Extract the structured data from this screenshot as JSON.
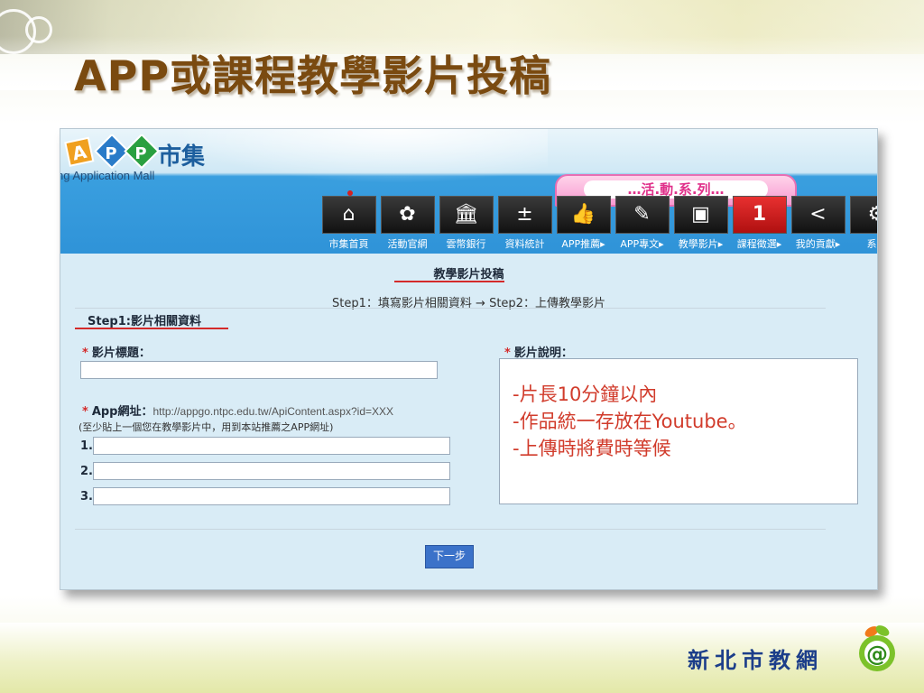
{
  "slide": {
    "title": "APP或課程教學影片投稿"
  },
  "site": {
    "logo_text": "市集",
    "logo_subtitle": "ng Application Mall",
    "event_banner": "…活.動.系.列…",
    "nav": [
      {
        "label": "市集首頁",
        "icon": "home-icon",
        "glyph": "⌂"
      },
      {
        "label": "活動官網",
        "icon": "activity-icon",
        "glyph": "✿"
      },
      {
        "label": "雲幣銀行",
        "icon": "bank-icon",
        "glyph": "🏛"
      },
      {
        "label": "資料統計",
        "icon": "calculator-icon",
        "glyph": "±"
      },
      {
        "label": "APP推薦▸",
        "icon": "thumbs-up-icon",
        "glyph": "👍"
      },
      {
        "label": "APP專文▸",
        "icon": "writer-icon",
        "glyph": "✎"
      },
      {
        "label": "教學影片▸",
        "icon": "video-icon",
        "glyph": "▣"
      },
      {
        "label": "課程徵選▸",
        "icon": "number-one-icon",
        "glyph": "1"
      },
      {
        "label": "我的貢獻▸",
        "icon": "share-icon",
        "glyph": "<"
      },
      {
        "label": "系統",
        "icon": "settings-icon",
        "glyph": "⚙"
      }
    ]
  },
  "form": {
    "title": "教學影片投稿",
    "steps": "Step1：填寫影片相關資料 → Step2：上傳教學影片",
    "section": "Step1:影片相關資料",
    "video_title_label": "影片標題：",
    "video_title_value": "",
    "app_url_label": "App網址：",
    "app_url_hint": "http://appgo.ntpc.edu.tw/ApiContent.aspx?id=XXX",
    "app_url_note": "(至少貼上一個您在教學影片中，用到本站推薦之APP網址)",
    "url_rows": [
      {
        "num": "1.",
        "value": ""
      },
      {
        "num": "2.",
        "value": ""
      },
      {
        "num": "3.",
        "value": ""
      }
    ],
    "desc_label": "影片說明：",
    "desc_lines": [
      "-片長10分鐘以內",
      "-作品統一存放在Youtube。",
      "-上傳時將費時等候"
    ],
    "next_button": "下一步",
    "required_mark": "*"
  },
  "footer": {
    "brand": "新北市教網",
    "brand_mark": "@"
  },
  "colors": {
    "accent_red": "#d42a2a",
    "header_blue": "#2f93d8",
    "title_brown": "#7a4a10",
    "button_blue": "#3b72c9"
  }
}
